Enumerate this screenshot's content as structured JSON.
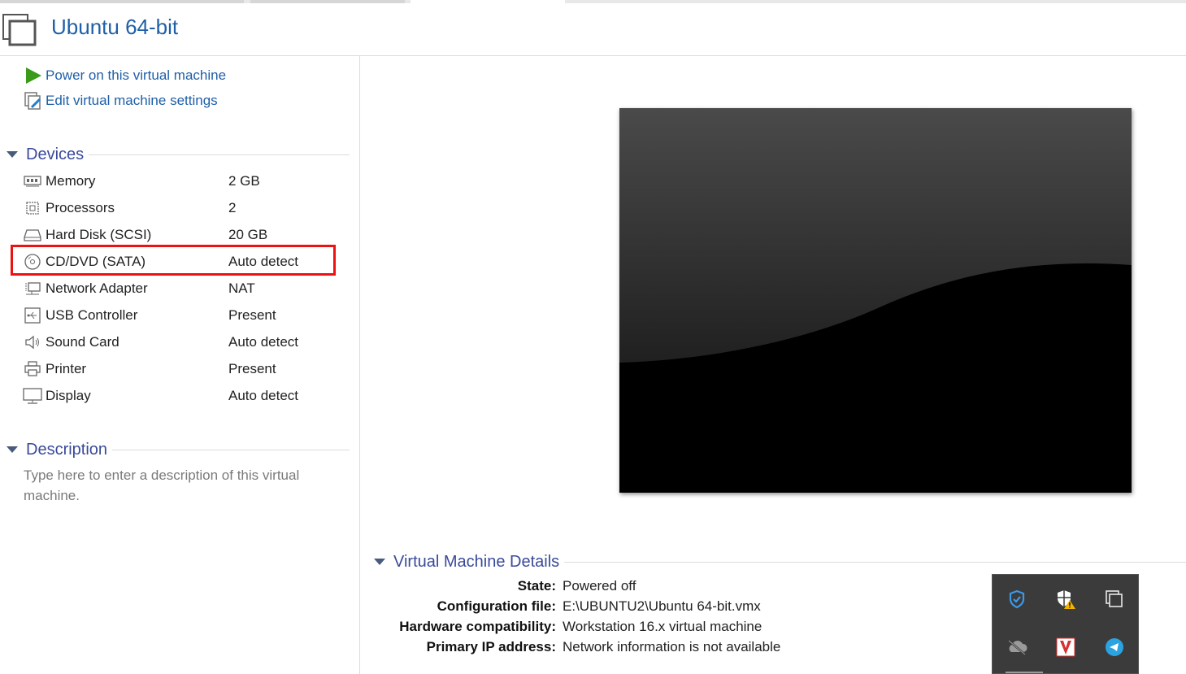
{
  "window": {
    "title": "Ubuntu 64-bit"
  },
  "actions": {
    "power_on": "Power on this virtual machine",
    "edit_settings": "Edit virtual machine settings"
  },
  "devices": {
    "heading": "Devices",
    "items": [
      {
        "name": "Memory",
        "value": "2 GB",
        "icon": "memory-icon"
      },
      {
        "name": "Processors",
        "value": "2",
        "icon": "processor-icon"
      },
      {
        "name": "Hard Disk (SCSI)",
        "value": "20 GB",
        "icon": "hard-disk-icon"
      },
      {
        "name": "CD/DVD (SATA)",
        "value": "Auto detect",
        "icon": "cd-dvd-icon",
        "highlighted": true
      },
      {
        "name": "Network Adapter",
        "value": "NAT",
        "icon": "network-adapter-icon"
      },
      {
        "name": "USB Controller",
        "value": "Present",
        "icon": "usb-icon"
      },
      {
        "name": "Sound Card",
        "value": "Auto detect",
        "icon": "speaker-icon"
      },
      {
        "name": "Printer",
        "value": "Present",
        "icon": "printer-icon"
      },
      {
        "name": "Display",
        "value": "Auto detect",
        "icon": "monitor-icon"
      }
    ]
  },
  "description": {
    "heading": "Description",
    "placeholder": "Type here to enter a description of this virtual machine."
  },
  "details": {
    "heading": "Virtual Machine Details",
    "rows": [
      {
        "label": "State:",
        "value": "Powered off"
      },
      {
        "label": "Configuration file:",
        "value": "E:\\UBUNTU2\\Ubuntu 64-bit.vmx"
      },
      {
        "label": "Hardware compatibility:",
        "value": "Workstation 16.x virtual machine"
      },
      {
        "label": "Primary IP address:",
        "value": "Network information is not available"
      }
    ]
  },
  "tray_icons": [
    "defender-shield-icon",
    "security-warning-icon",
    "window-switch-icon",
    "onedrive-cloud-icon",
    "antivirus-v-icon",
    "telegram-icon"
  ],
  "colors": {
    "link": "#1f5fa8",
    "heading": "#3a4a9a",
    "highlight": "#ee1111",
    "play": "#3a9a1a"
  }
}
